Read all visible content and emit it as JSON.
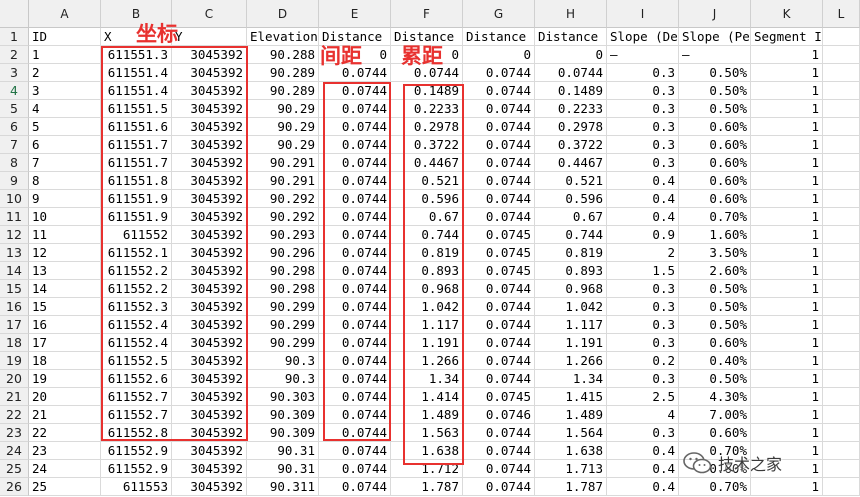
{
  "columns": [
    "A",
    "B",
    "C",
    "D",
    "E",
    "F",
    "G",
    "H",
    "I",
    "J",
    "K",
    "L"
  ],
  "row_numbers": [
    1,
    2,
    3,
    4,
    5,
    6,
    7,
    8,
    9,
    10,
    11,
    12,
    13,
    14,
    15,
    16,
    17,
    18,
    19,
    20,
    21,
    22,
    23,
    24,
    25,
    26
  ],
  "selected_row": 4,
  "header_row": [
    "ID",
    "X",
    "Y",
    "Elevation",
    "Distance",
    "Distance",
    "Distance",
    "Distance",
    "Slope (De",
    "Slope (Pe",
    "Segment Index",
    ""
  ],
  "rows": [
    [
      "1",
      "611551.3",
      "3045392",
      "90.288",
      "0",
      "0",
      "0",
      "0",
      "—",
      "—",
      "1",
      ""
    ],
    [
      "2",
      "611551.4",
      "3045392",
      "90.289",
      "0.0744",
      "0.0744",
      "0.0744",
      "0.0744",
      "0.3",
      "0.50%",
      "1",
      ""
    ],
    [
      "3",
      "611551.4",
      "3045392",
      "90.289",
      "0.0744",
      "0.1489",
      "0.0744",
      "0.1489",
      "0.3",
      "0.50%",
      "1",
      ""
    ],
    [
      "4",
      "611551.5",
      "3045392",
      "90.29",
      "0.0744",
      "0.2233",
      "0.0744",
      "0.2233",
      "0.3",
      "0.50%",
      "1",
      ""
    ],
    [
      "5",
      "611551.6",
      "3045392",
      "90.29",
      "0.0744",
      "0.2978",
      "0.0744",
      "0.2978",
      "0.3",
      "0.60%",
      "1",
      ""
    ],
    [
      "6",
      "611551.7",
      "3045392",
      "90.29",
      "0.0744",
      "0.3722",
      "0.0744",
      "0.3722",
      "0.3",
      "0.60%",
      "1",
      ""
    ],
    [
      "7",
      "611551.7",
      "3045392",
      "90.291",
      "0.0744",
      "0.4467",
      "0.0744",
      "0.4467",
      "0.3",
      "0.60%",
      "1",
      ""
    ],
    [
      "8",
      "611551.8",
      "3045392",
      "90.291",
      "0.0744",
      "0.521",
      "0.0744",
      "0.521",
      "0.4",
      "0.60%",
      "1",
      ""
    ],
    [
      "9",
      "611551.9",
      "3045392",
      "90.292",
      "0.0744",
      "0.596",
      "0.0744",
      "0.596",
      "0.4",
      "0.60%",
      "1",
      ""
    ],
    [
      "10",
      "611551.9",
      "3045392",
      "90.292",
      "0.0744",
      "0.67",
      "0.0744",
      "0.67",
      "0.4",
      "0.70%",
      "1",
      ""
    ],
    [
      "11",
      "611552",
      "3045392",
      "90.293",
      "0.0744",
      "0.744",
      "0.0745",
      "0.744",
      "0.9",
      "1.60%",
      "1",
      ""
    ],
    [
      "12",
      "611552.1",
      "3045392",
      "90.296",
      "0.0744",
      "0.819",
      "0.0745",
      "0.819",
      "2",
      "3.50%",
      "1",
      ""
    ],
    [
      "13",
      "611552.2",
      "3045392",
      "90.298",
      "0.0744",
      "0.893",
      "0.0745",
      "0.893",
      "1.5",
      "2.60%",
      "1",
      ""
    ],
    [
      "14",
      "611552.2",
      "3045392",
      "90.298",
      "0.0744",
      "0.968",
      "0.0744",
      "0.968",
      "0.3",
      "0.50%",
      "1",
      ""
    ],
    [
      "15",
      "611552.3",
      "3045392",
      "90.299",
      "0.0744",
      "1.042",
      "0.0744",
      "1.042",
      "0.3",
      "0.50%",
      "1",
      ""
    ],
    [
      "16",
      "611552.4",
      "3045392",
      "90.299",
      "0.0744",
      "1.117",
      "0.0744",
      "1.117",
      "0.3",
      "0.50%",
      "1",
      ""
    ],
    [
      "17",
      "611552.4",
      "3045392",
      "90.299",
      "0.0744",
      "1.191",
      "0.0744",
      "1.191",
      "0.3",
      "0.60%",
      "1",
      ""
    ],
    [
      "18",
      "611552.5",
      "3045392",
      "90.3",
      "0.0744",
      "1.266",
      "0.0744",
      "1.266",
      "0.2",
      "0.40%",
      "1",
      ""
    ],
    [
      "19",
      "611552.6",
      "3045392",
      "90.3",
      "0.0744",
      "1.34",
      "0.0744",
      "1.34",
      "0.3",
      "0.50%",
      "1",
      ""
    ],
    [
      "20",
      "611552.7",
      "3045392",
      "90.303",
      "0.0744",
      "1.414",
      "0.0745",
      "1.415",
      "2.5",
      "4.30%",
      "1",
      ""
    ],
    [
      "21",
      "611552.7",
      "3045392",
      "90.309",
      "0.0744",
      "1.489",
      "0.0746",
      "1.489",
      "4",
      "7.00%",
      "1",
      ""
    ],
    [
      "22",
      "611552.8",
      "3045392",
      "90.309",
      "0.0744",
      "1.563",
      "0.0744",
      "1.564",
      "0.3",
      "0.60%",
      "1",
      ""
    ],
    [
      "23",
      "611552.9",
      "3045392",
      "90.31",
      "0.0744",
      "1.638",
      "0.0744",
      "1.638",
      "0.4",
      "0.70%",
      "1",
      ""
    ],
    [
      "24",
      "611552.9",
      "3045392",
      "90.31",
      "0.0744",
      "1.712",
      "0.0744",
      "1.713",
      "0.4",
      "0.60%",
      "1",
      ""
    ],
    [
      "25",
      "611553",
      "3045392",
      "90.311",
      "0.0744",
      "1.787",
      "0.0744",
      "1.787",
      "0.4",
      "0.70%",
      "1",
      ""
    ]
  ],
  "annotations": {
    "coords_label": "坐标",
    "spacing_label": "间距",
    "cumulative_label": "累距"
  },
  "watermark": {
    "text": "技术之家",
    "icon": "wechat-icon"
  },
  "colors": {
    "annotation": "#e8312f",
    "selected_row_header": "#217346",
    "header_bg": "#f0f0f0"
  }
}
